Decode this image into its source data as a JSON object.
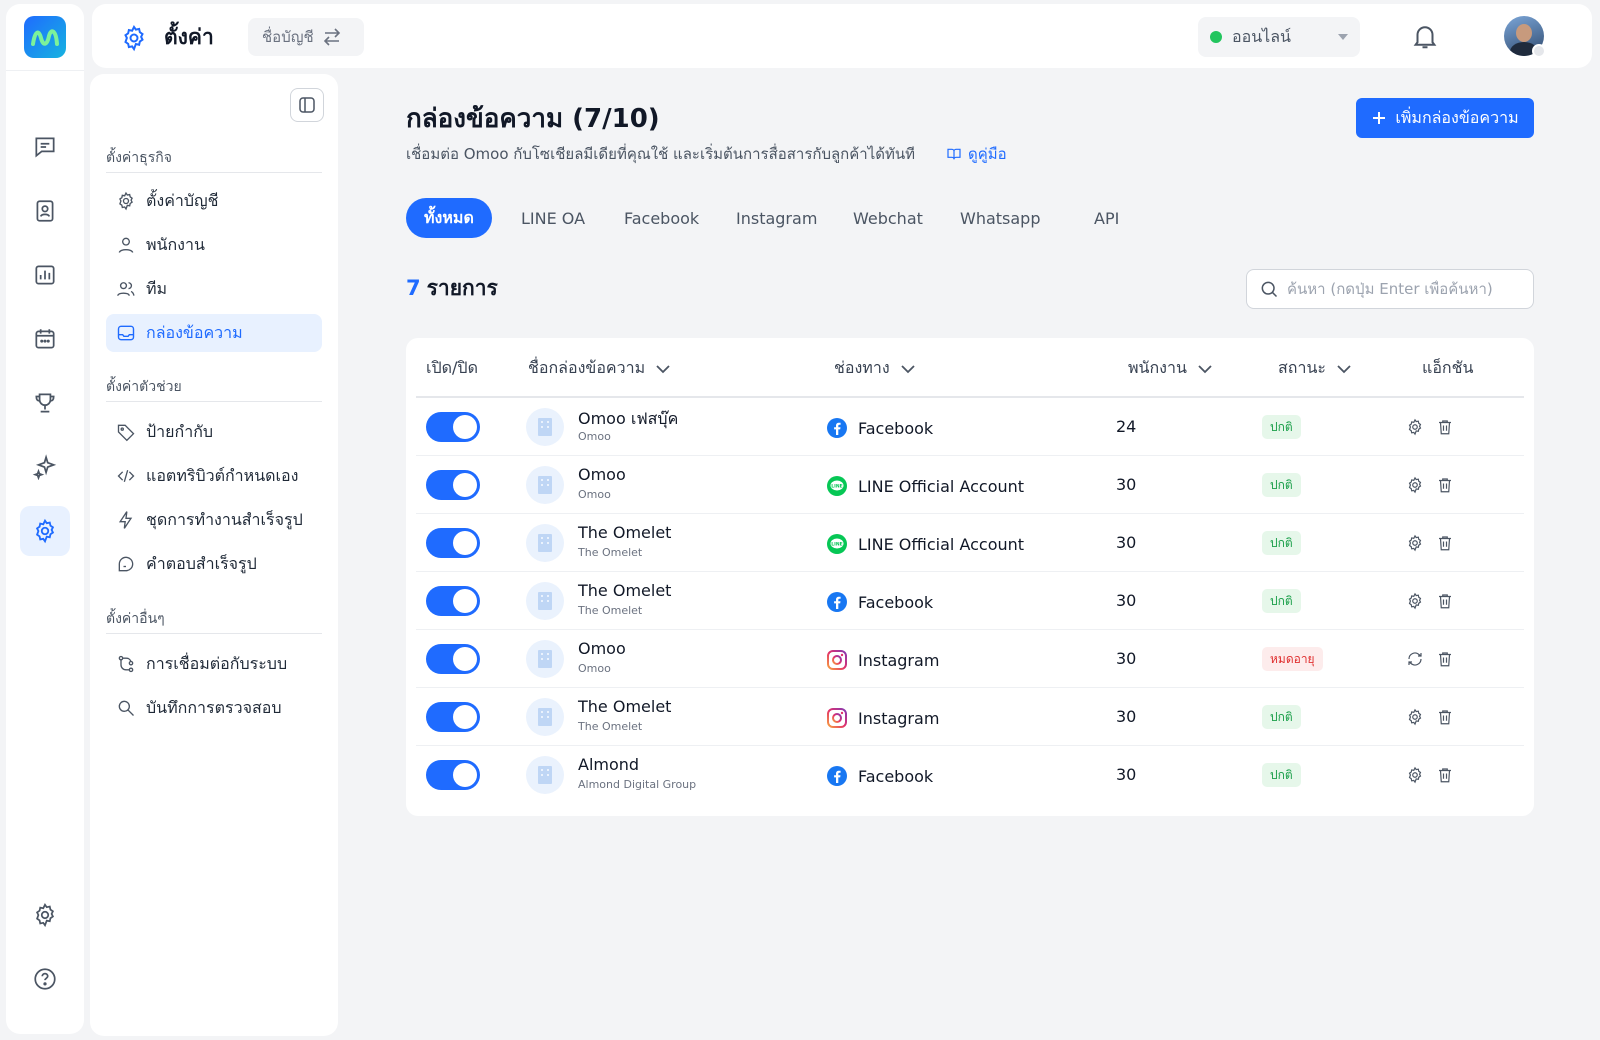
{
  "topbar": {
    "title": "ตั้งค่า",
    "account_button": "ชื่อบัญชี",
    "status": "ออนไลน์"
  },
  "sidebar": {
    "sections": [
      {
        "title": "ตั้งค่าธุรกิจ",
        "items": [
          "ตั้งค่าบัญชี",
          "พนักงาน",
          "ทีม",
          "กล่องข้อความ"
        ]
      },
      {
        "title": "ตั้งค่าตัวช่วย",
        "items": [
          "ป้ายกำกับ",
          "แอตทริบิวต์กำหนดเอง",
          "ชุดการทำงานสำเร็จรูป",
          "คำตอบสำเร็จรูป"
        ]
      },
      {
        "title": "ตั้งค่าอื่นๆ",
        "items": [
          "การเชื่อมต่อกับระบบ",
          "บันทึกการตรวจสอบ"
        ]
      }
    ]
  },
  "main": {
    "title": "กล่องข้อความ (7/10)",
    "subtitle": "เชื่อมต่อ Omoo กับโซเชียลมีเดียที่คุณใช้ และเริ่มต้นการสื่อสารกับลูกค้าได้ทันที",
    "guide_link": "ดูคู่มือ",
    "add_button": "เพิ่มกล่องข้อความ",
    "tabs": [
      "ทั้งหมด",
      "LINE OA",
      "Facebook",
      "Instagram",
      "Webchat",
      "Whatsapp",
      "API"
    ],
    "count_number": "7",
    "count_label": "รายการ",
    "search_placeholder": "ค้นหา (กดปุ่ม Enter เพื่อค้นหา)"
  },
  "table": {
    "headers": {
      "toggle": "เปิด/ปิด",
      "name": "ชื่อกล่องข้อความ",
      "channel": "ช่องทาง",
      "staff": "พนักงาน",
      "status": "สถานะ",
      "action": "แอ็กชัน"
    },
    "rows": [
      {
        "name": "Omoo เฟสบุ๊ค",
        "sub": "Omoo",
        "channel": "Facebook",
        "staff": "24",
        "status": "ปกติ"
      },
      {
        "name": "Omoo",
        "sub": "Omoo",
        "channel": "LINE Official Account",
        "staff": "30",
        "status": "ปกติ"
      },
      {
        "name": "The Omelet",
        "sub": "The Omelet",
        "channel": "LINE Official Account",
        "staff": "30",
        "status": "ปกติ"
      },
      {
        "name": "The Omelet",
        "sub": "The Omelet",
        "channel": "Facebook",
        "staff": "30",
        "status": "ปกติ"
      },
      {
        "name": "Omoo",
        "sub": "Omoo",
        "channel": "Instagram",
        "staff": "30",
        "status": "หมดอายุ"
      },
      {
        "name": "The Omelet",
        "sub": "The Omelet",
        "channel": "Instagram",
        "staff": "30",
        "status": "ปกติ"
      },
      {
        "name": "Almond",
        "sub": "Almond Digital Group",
        "channel": "Facebook",
        "staff": "30",
        "status": "ปกติ"
      }
    ]
  },
  "colors": {
    "accent": "#1f6bff",
    "ok": "#1a9f49",
    "expired": "#e03131",
    "line": "#06c755",
    "facebook": "#1877f2"
  }
}
